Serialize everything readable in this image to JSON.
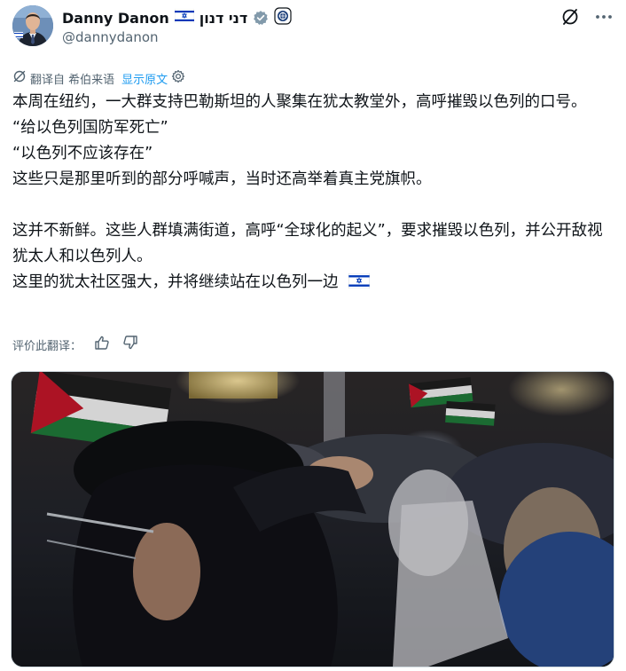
{
  "author": {
    "display_name": "Danny Danon",
    "hebrew_name": "דני דנון",
    "handle": "@dannydanon"
  },
  "header_actions": {
    "grok_icon": "grok-icon",
    "more_icon": "more-icon"
  },
  "translation": {
    "translated_from": "翻译自 希伯来语",
    "show_original": "显示原文"
  },
  "tweet": {
    "paragraph_1": "本周在纽约，一大群支持巴勒斯坦的人聚集在犹太教堂外，高呼摧毁以色列的口号。",
    "quote_1": "“给以色列国防军死亡”",
    "quote_2": "“以色列不应该存在”",
    "paragraph_2": "这些只是那里听到的部分呼喊声，当时还高举着真主党旗帜。",
    "paragraph_3": "这并不新鲜。这些人群填满街道，高呼“全球化的起义”，要求摧毁以色列，并公开敌视犹太人和以色列人。",
    "paragraph_4": "这里的犹太社区强大，并将继续站在以色列一边"
  },
  "rate_translation": {
    "label": "评价此翻译："
  },
  "colors": {
    "text": "#0f1419",
    "secondary": "#536471",
    "link": "#1d9bf0",
    "verified": "#829aab",
    "israel_blue": "#0038b8"
  }
}
